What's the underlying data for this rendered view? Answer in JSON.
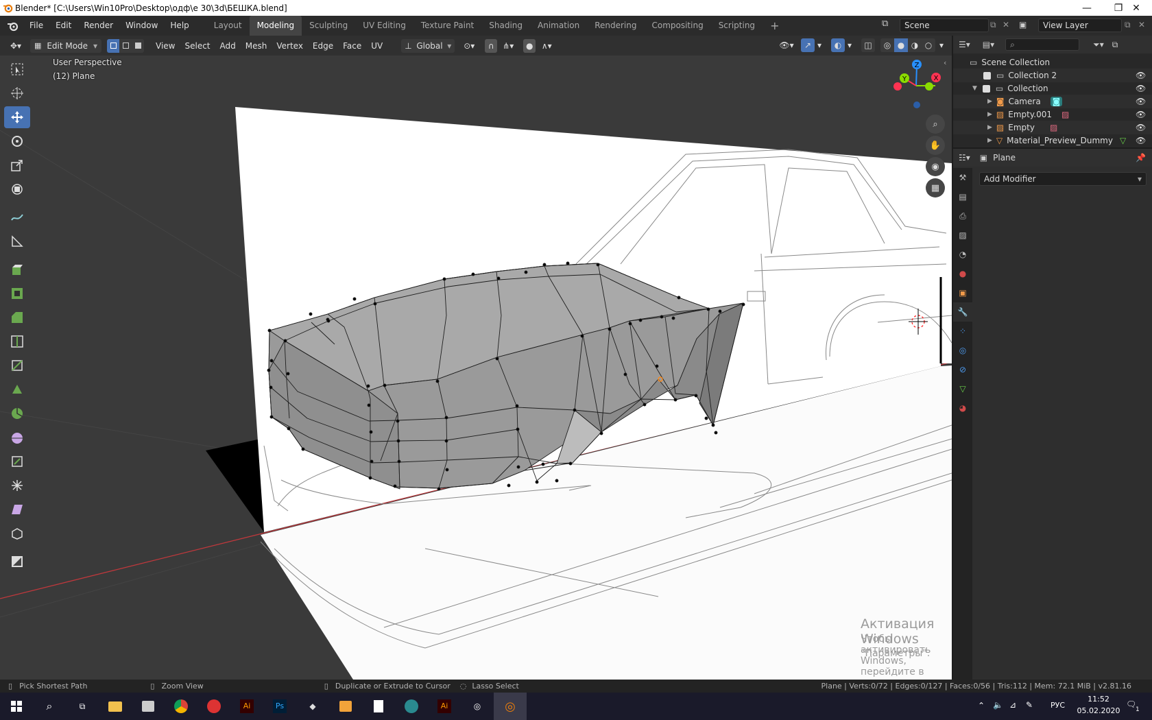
{
  "window": {
    "title": "Blender* [C:\\Users\\Win10Pro\\Desktop\\одф\\е 30\\3d\\БЕШКА.blend]"
  },
  "menu": [
    "File",
    "Edit",
    "Render",
    "Window",
    "Help"
  ],
  "workspaces": [
    {
      "label": "Layout",
      "active": false
    },
    {
      "label": "Modeling",
      "active": true
    },
    {
      "label": "Sculpting",
      "active": false
    },
    {
      "label": "UV Editing",
      "active": false
    },
    {
      "label": "Texture Paint",
      "active": false
    },
    {
      "label": "Shading",
      "active": false
    },
    {
      "label": "Animation",
      "active": false
    },
    {
      "label": "Rendering",
      "active": false
    },
    {
      "label": "Compositing",
      "active": false
    },
    {
      "label": "Scripting",
      "active": false
    }
  ],
  "scene": {
    "name": "Scene",
    "view_layer": "View Layer"
  },
  "header3d": {
    "mode": "Edit Mode",
    "menus": [
      "View",
      "Select",
      "Add",
      "Mesh",
      "Vertex",
      "Edge",
      "Face",
      "UV"
    ],
    "orientation": "Global"
  },
  "viewport": {
    "perspective": "User Perspective",
    "object": "(12) Plane"
  },
  "gizmo": {
    "z": "Z",
    "y": "Y",
    "x": "X"
  },
  "outliner": {
    "root": "Scene Collection",
    "items": [
      {
        "name": "Collection 2"
      },
      {
        "name": "Collection"
      },
      {
        "name": "Camera"
      },
      {
        "name": "Empty.001"
      },
      {
        "name": "Empty"
      },
      {
        "name": "Material_Preview_Dummy"
      }
    ]
  },
  "properties": {
    "object": "Plane",
    "add_modifier": "Add Modifier"
  },
  "statusbar": {
    "left": [
      "Pick Shortest Path",
      "Zoom View",
      "Duplicate or Extrude to Cursor",
      "Lasso Select"
    ],
    "right": "Plane | Verts:0/72 | Edges:0/127 | Faces:0/56 | Tris:112 | Mem: 72.1 MiB | v2.81.16"
  },
  "watermark": {
    "title": "Активация Windows",
    "line1": "Чтобы активировать Windows, перейдите в раздел",
    "line2": "\"Параметры\"."
  },
  "taskbar": {
    "lang": "РУС",
    "time": "11:52",
    "date": "05.02.2020",
    "notif_count": "1"
  },
  "colors": {
    "accent": "#4772b3",
    "select": "#ff8c1a",
    "axis_x": "#ff3352",
    "axis_y": "#8bdc00",
    "axis_z": "#2890ff"
  }
}
